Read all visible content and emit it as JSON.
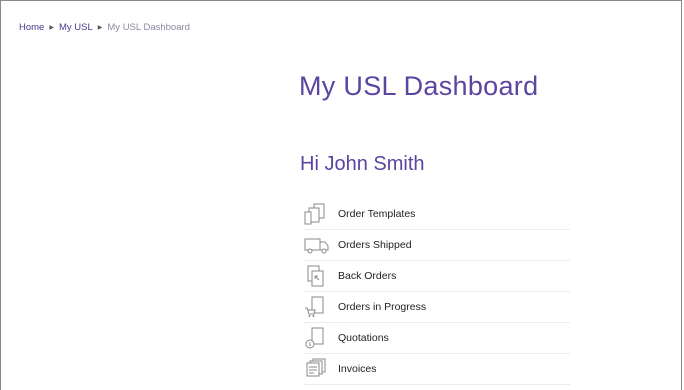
{
  "breadcrumb": {
    "home": "Home",
    "my_usl": "My USL",
    "current": "My USL Dashboard"
  },
  "page": {
    "title": "My USL Dashboard",
    "greeting": "Hi John Smith"
  },
  "menu": {
    "items": [
      {
        "label": "Order Templates",
        "icon": "order-templates-icon"
      },
      {
        "label": "Orders Shipped",
        "icon": "truck-icon"
      },
      {
        "label": "Back Orders",
        "icon": "back-orders-icon"
      },
      {
        "label": "Orders in Progress",
        "icon": "cart-icon"
      },
      {
        "label": "Quotations",
        "icon": "quotation-icon"
      },
      {
        "label": "Invoices",
        "icon": "invoice-icon"
      }
    ]
  },
  "colors": {
    "accent": "#5a45a0",
    "link": "#4a3a8c",
    "icon_stroke": "#8a8a8a"
  }
}
